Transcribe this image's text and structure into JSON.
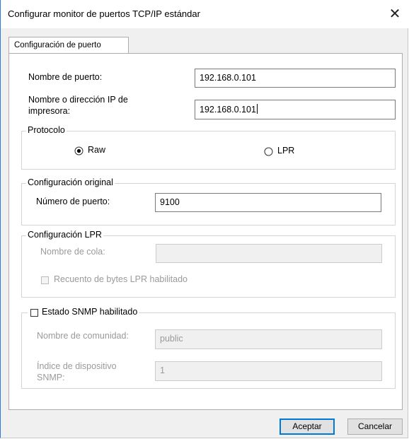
{
  "window": {
    "title": "Configurar monitor de puertos TCP/IP estándar",
    "close_glyph": "✕"
  },
  "tab": {
    "label": "Configuración de puerto"
  },
  "port_name": {
    "label": "Nombre de puerto:",
    "value": "192.168.0.101"
  },
  "printer_address": {
    "label_line1": "Nombre o dirección IP de",
    "label_line2": "impresora:",
    "value": "192.168.0.101"
  },
  "protocol": {
    "legend": "Protocolo",
    "options": [
      {
        "label": "Raw",
        "selected": true
      },
      {
        "label": "LPR",
        "selected": false
      }
    ]
  },
  "raw_settings": {
    "legend": "Configuración original",
    "port_number_label": "Número de puerto:",
    "port_number_value": "9100"
  },
  "lpr_settings": {
    "legend": "Configuración LPR",
    "queue_name_label": "Nombre de cola:",
    "queue_name_value": "",
    "byte_count_label": "Recuento de bytes LPR habilitado",
    "byte_count_checked": false
  },
  "snmp": {
    "legend": "Estado SNMP habilitado",
    "enabled": false,
    "community_label": "Nombre de comunidad:",
    "community_value": "public",
    "device_index_label_line1": "Índice de dispositivo",
    "device_index_label_line2": "SNMP:",
    "device_index_value": "1"
  },
  "buttons": {
    "ok": "Aceptar",
    "cancel": "Cancelar"
  }
}
